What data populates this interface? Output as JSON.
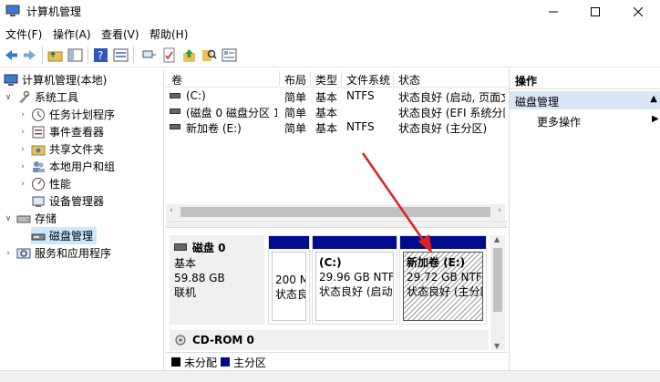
{
  "window": {
    "title": "计算机管理"
  },
  "menu": [
    "文件(F)",
    "操作(A)",
    "查看(V)",
    "帮助(H)"
  ],
  "tree": {
    "root": "计算机管理(本地)",
    "system_tools": "系统工具",
    "task_scheduler": "任务计划程序",
    "event_viewer": "事件查看器",
    "shared_folders": "共享文件夹",
    "local_users": "本地用户和组",
    "performance": "性能",
    "device_manager": "设备管理器",
    "storage": "存储",
    "disk_management": "磁盘管理",
    "services_apps": "服务和应用程序"
  },
  "table": {
    "headers": {
      "volume": "卷",
      "layout": "布局",
      "type": "类型",
      "fs": "文件系统",
      "status": "状态"
    },
    "rows": [
      {
        "volume": "(C:)",
        "layout": "简单",
        "type": "基本",
        "fs": "NTFS",
        "status": "状态良好 (启动, 页面文"
      },
      {
        "volume": "(磁盘 0 磁盘分区 1)",
        "layout": "简单",
        "type": "基本",
        "fs": "",
        "status": "状态良好 (EFI 系统分区"
      },
      {
        "volume": "新加卷 (E:)",
        "layout": "简单",
        "type": "基本",
        "fs": "NTFS",
        "status": "状态良好 (主分区)"
      }
    ]
  },
  "disk0": {
    "name": "磁盘 0",
    "type": "基本",
    "size": "59.88 GB",
    "state": "联机",
    "partitions": [
      {
        "line1": "200 M",
        "line2": "状态良"
      },
      {
        "label": "(C:)",
        "line1": "29.96 GB NTFS",
        "line2": "状态良好 (启动,"
      },
      {
        "label": "新加卷  (E:)",
        "line1": "29.72 GB NTFS",
        "line2": "状态良好 (主分区"
      }
    ]
  },
  "cdrom": {
    "name": "CD-ROM 0"
  },
  "legend": {
    "unallocated": "未分配",
    "primary": "主分区"
  },
  "actions": {
    "header": "操作",
    "selected": "磁盘管理",
    "more": "更多操作"
  },
  "colors": {
    "partition_header": "#000c8c",
    "selection": "#cce8ff",
    "arrow": "#e02020"
  }
}
